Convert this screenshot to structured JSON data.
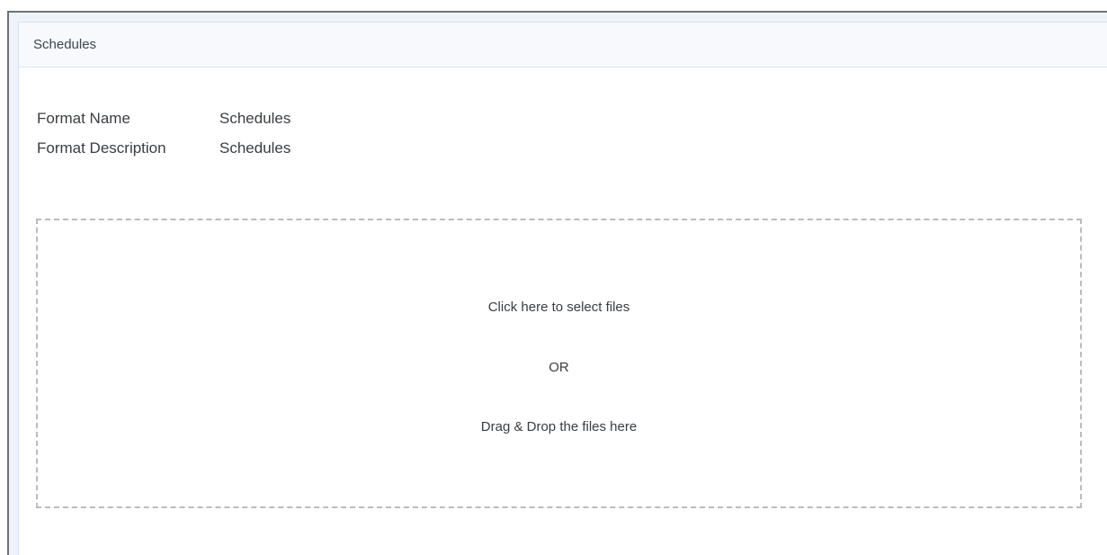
{
  "panel": {
    "title": "Schedules"
  },
  "format": {
    "name_label": "Format Name",
    "name_value": "Schedules",
    "description_label": "Format Description",
    "description_value": "Schedules"
  },
  "upload": {
    "click_text": "Click here to select files",
    "or_text": "OR",
    "drag_text": "Drag & Drop the files here"
  }
}
